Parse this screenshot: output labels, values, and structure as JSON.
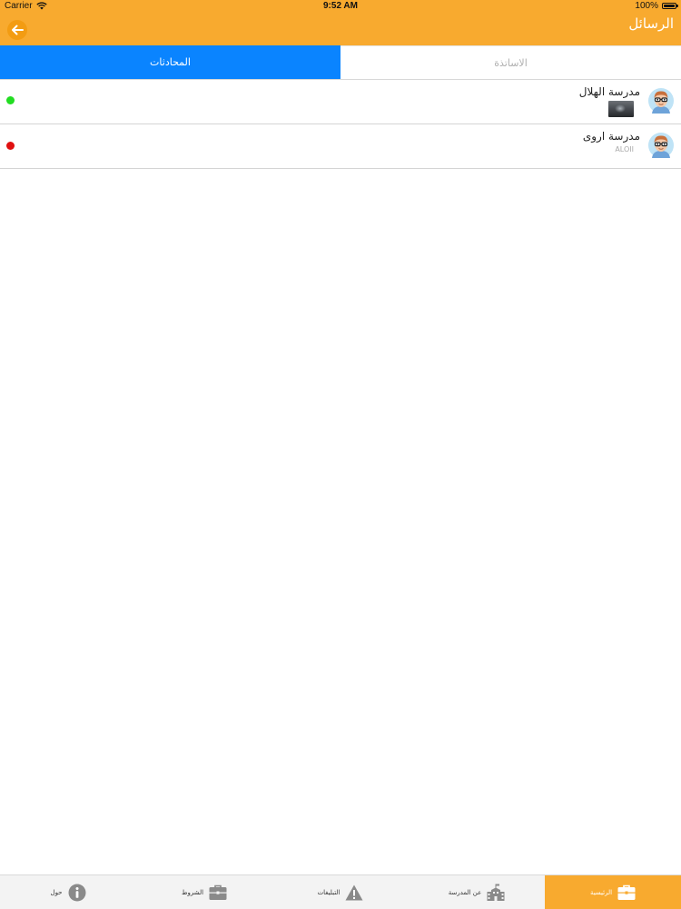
{
  "status_bar": {
    "carrier": "Carrier",
    "time": "9:52 AM",
    "battery": "100%"
  },
  "header": {
    "title": "الرسائل"
  },
  "tabs": [
    {
      "label": "الاساتذة",
      "active": false
    },
    {
      "label": "المحادثات",
      "active": true
    }
  ],
  "conversations": [
    {
      "name": "مدرسة الهلال",
      "subtitle": "",
      "status_color": "#22dd22"
    },
    {
      "name": "مدرسة اروى",
      "subtitle": "ALOII",
      "status_color": "#e01010"
    }
  ],
  "tab_bar": [
    {
      "label": "الرئيسية",
      "icon": "briefcase-icon",
      "active": true
    },
    {
      "label": "عن المدرسة",
      "icon": "school-icon",
      "active": false
    },
    {
      "label": "التبليغات",
      "icon": "warning-icon",
      "active": false
    },
    {
      "label": "الشروط",
      "icon": "briefcase-icon",
      "active": false
    },
    {
      "label": "حول",
      "icon": "info-icon",
      "active": false
    }
  ],
  "colors": {
    "accent": "#f8aa2f",
    "tab_active": "#0a84ff",
    "online": "#22dd22",
    "offline": "#e01010"
  }
}
